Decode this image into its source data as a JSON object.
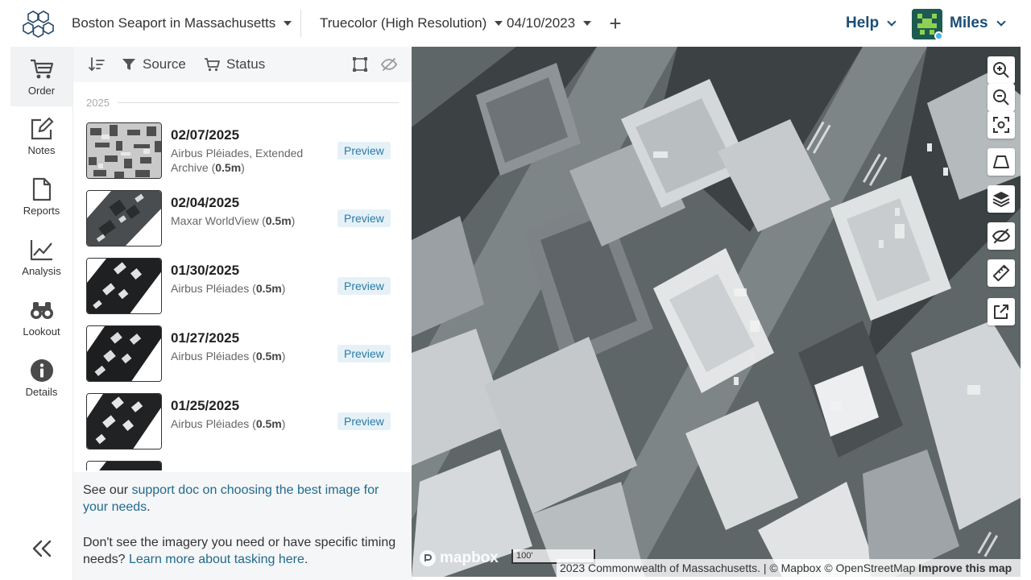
{
  "header": {
    "location": "Boston Seaport in Massachusetts",
    "layer": "Truecolor (High Resolution)",
    "date": "04/10/2023",
    "add_icon": "plus-icon",
    "help_label": "Help",
    "user_name": "Miles"
  },
  "sidebar": {
    "items": [
      {
        "label": "Order",
        "icon": "cart-icon"
      },
      {
        "label": "Notes",
        "icon": "edit-icon"
      },
      {
        "label": "Reports",
        "icon": "document-icon"
      },
      {
        "label": "Analysis",
        "icon": "line-chart-icon"
      },
      {
        "label": "Lookout",
        "icon": "binoculars-icon"
      },
      {
        "label": "Details",
        "icon": "info-icon"
      }
    ],
    "collapse_icon": "double-chevron-left-icon"
  },
  "panel": {
    "toolbar": {
      "sort_icon": "sort-icon",
      "source_label": "Source",
      "status_label": "Status",
      "bbox_icon": "bounding-box-icon",
      "hide_icon": "eye-off-icon"
    },
    "year": "2025",
    "images": [
      {
        "date": "02/07/2025",
        "source": "Airbus Pléiades, Extended Archive",
        "resolution": "0.5m",
        "action": "Preview"
      },
      {
        "date": "02/04/2025",
        "source": "Maxar WorldView",
        "resolution": "0.5m",
        "action": "Preview"
      },
      {
        "date": "01/30/2025",
        "source": "Airbus Pléiades",
        "resolution": "0.5m",
        "action": "Preview"
      },
      {
        "date": "01/27/2025",
        "source": "Airbus Pléiades",
        "resolution": "0.5m",
        "action": "Preview"
      },
      {
        "date": "01/25/2025",
        "source": "Airbus Pléiades",
        "resolution": "0.5m",
        "action": "Preview"
      }
    ],
    "footer": {
      "line1_prefix": "See our ",
      "line1_link": "support doc on choosing the best image for your needs",
      "line1_suffix": ".",
      "line2_prefix": "Don't see the imagery you need or have specific timing needs? ",
      "line2_link": "Learn more about tasking here",
      "line2_suffix": "."
    }
  },
  "map": {
    "tools": [
      "zoom-in-icon",
      "zoom-out-icon",
      "fit-bounds-icon",
      "draw-polygon-icon",
      "layers-icon",
      "eye-off-icon",
      "ruler-icon",
      "external-link-icon"
    ],
    "logo_text": "mapbox",
    "scale_label": "100'",
    "attribution_1": "2023 Commonwealth of Massachusetts. | © Mapbox © OpenStreetMap",
    "attribution_link": "Improve this map"
  },
  "colors": {
    "brand_blue": "#1a4e76",
    "preview_bg": "#e6f1f7",
    "preview_text": "#2b7aa8",
    "panel_bg": "#f5f6f7"
  }
}
